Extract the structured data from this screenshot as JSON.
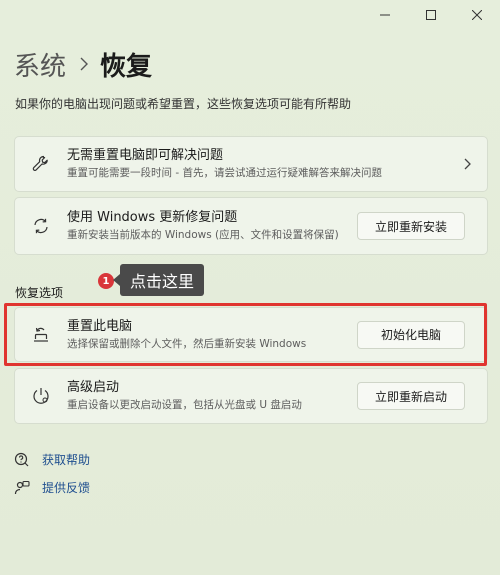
{
  "window": {
    "controls": {
      "minimize": "—",
      "maximize": "☐",
      "close": "✕"
    }
  },
  "breadcrumb": {
    "parent": "系统",
    "current": "恢复"
  },
  "subtitle": "如果你的电脑出现问题或希望重置，这些恢复选项可能有所帮助",
  "cards": {
    "troubleshoot": {
      "title": "无需重置电脑即可解决问题",
      "desc": "重置可能需要一段时间 - 首先，请尝试通过运行疑难解答来解决问题"
    },
    "windows_update": {
      "title": "使用 Windows 更新修复问题",
      "desc": "重新安装当前版本的 Windows (应用、文件和设置将保留)",
      "button": "立即重新安装"
    },
    "reset_pc": {
      "title": "重置此电脑",
      "desc": "选择保留或删除个人文件，然后重新安装 Windows",
      "button": "初始化电脑"
    },
    "advanced_startup": {
      "title": "高级启动",
      "desc": "重启设备以更改启动设置，包括从光盘或 U 盘启动",
      "button": "立即重新启动"
    }
  },
  "section_label": "恢复选项",
  "annotation": {
    "badge": "1",
    "tooltip": "点击这里",
    "highlight_color": "#e0342f"
  },
  "links": {
    "help": "获取帮助",
    "feedback": "提供反馈"
  }
}
